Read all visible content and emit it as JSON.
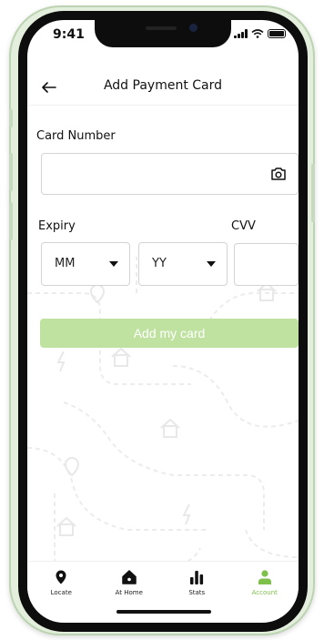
{
  "status_bar": {
    "time": "9:41"
  },
  "header": {
    "title": "Add Payment Card"
  },
  "form": {
    "card_number_label": "Card Number",
    "card_number_value": "",
    "expiry_label": "Expiry",
    "month_value": "MM",
    "year_value": "YY",
    "cvv_label": "CVV",
    "cvv_value": "",
    "submit_label": "Add my card"
  },
  "tabs": [
    {
      "label": "Locate",
      "icon": "location-pin-icon",
      "active": false
    },
    {
      "label": "At Home",
      "icon": "house-icon",
      "active": false
    },
    {
      "label": "Stats",
      "icon": "bar-chart-icon",
      "active": false
    },
    {
      "label": "Account",
      "icon": "user-icon",
      "active": true
    }
  ],
  "colors": {
    "accent": "#7ec04a",
    "button_disabled": "#bfe2a0",
    "frame": "#e3efdc"
  }
}
